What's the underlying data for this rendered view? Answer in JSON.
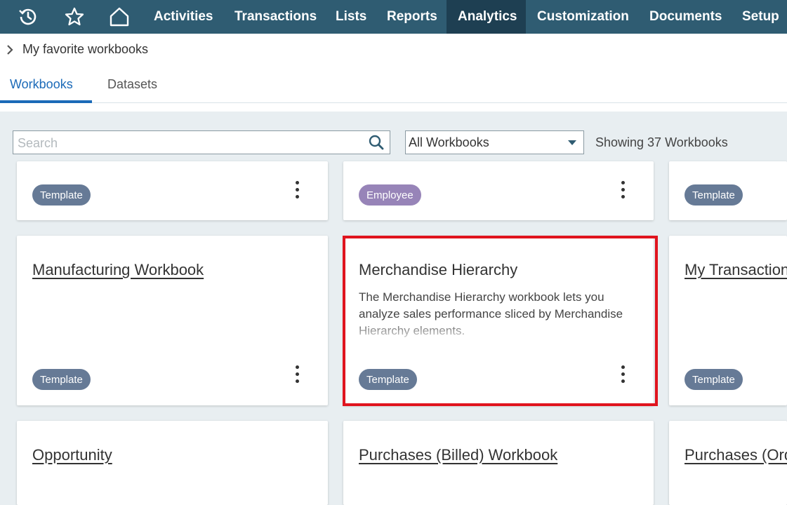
{
  "nav": {
    "icons": [
      "recent-icon",
      "star-icon",
      "home-icon"
    ],
    "items": [
      "Activities",
      "Transactions",
      "Lists",
      "Reports",
      "Analytics",
      "Customization",
      "Documents",
      "Setup"
    ],
    "active": "Analytics"
  },
  "breadcrumb": {
    "label": "My favorite workbooks"
  },
  "tabs": {
    "workbooks": "Workbooks",
    "datasets": "Datasets"
  },
  "toolbar": {
    "search_placeholder": "Search",
    "filter_value": "All Workbooks",
    "count_text": "Showing 37 Workbooks"
  },
  "cards": {
    "row1": [
      {
        "badge": "Template"
      },
      {
        "badge": "Employee"
      },
      {
        "badge": "Template"
      }
    ],
    "row2": [
      {
        "title": "Manufacturing Workbook",
        "badge": "Template"
      },
      {
        "title": "Merchandise Hierarchy",
        "description": "The Merchandise Hierarchy workbook lets you analyze sales performance sliced by Merchandise Hierarchy elements.",
        "badge": "Template"
      },
      {
        "title": "My Transactions",
        "badge": "Template"
      }
    ],
    "row3": [
      {
        "title": "Opportunity"
      },
      {
        "title": "Purchases (Billed) Workbook"
      },
      {
        "title": "Purchases (Ordered) Workbook"
      }
    ]
  },
  "colors": {
    "nav_bg": "#2f5c72",
    "nav_active": "#1e3f52",
    "accent": "#1b6ab8",
    "badge_template": "#667a96",
    "badge_employee": "#9784b8",
    "highlight": "#e0141e"
  }
}
